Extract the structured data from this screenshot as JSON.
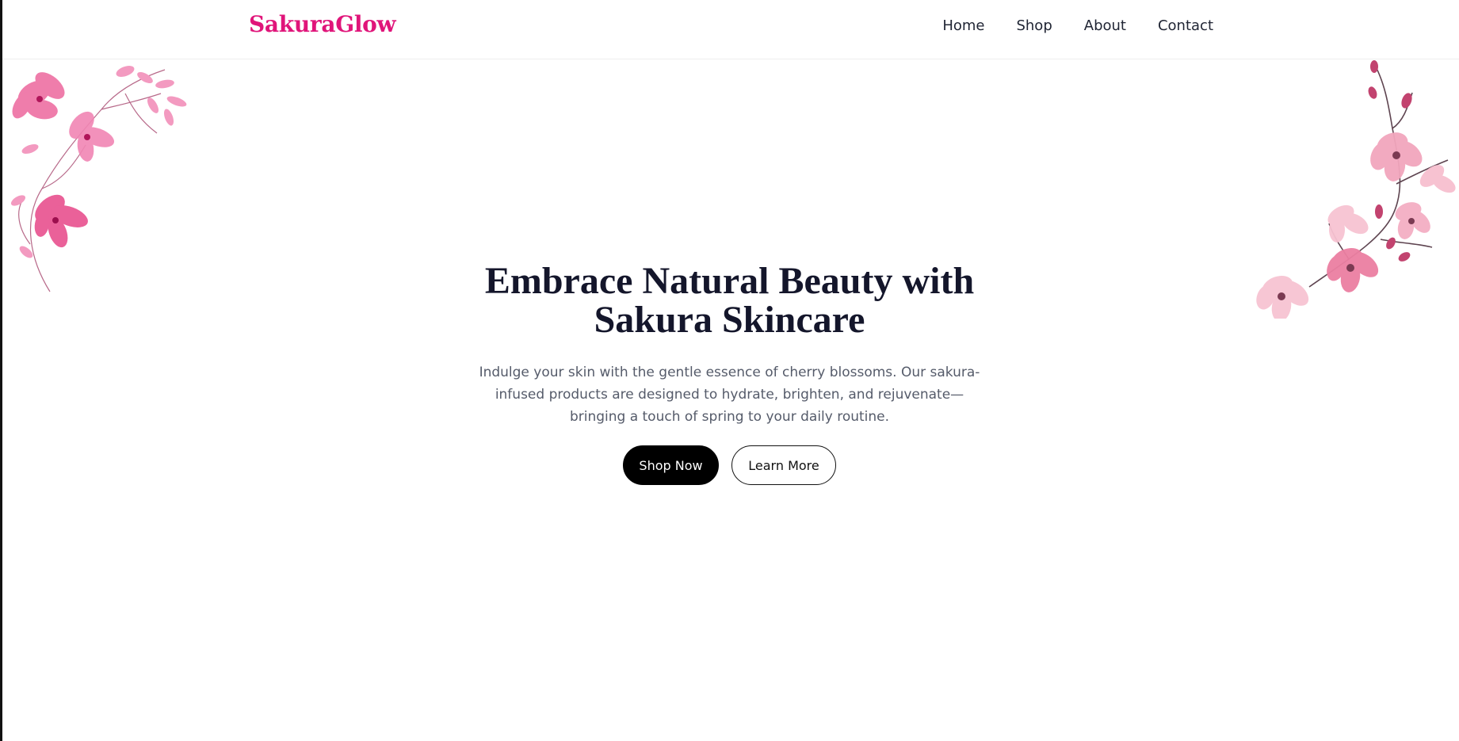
{
  "colors": {
    "brand": "#e0157a",
    "heading": "#14162b",
    "body_text": "#555b6a",
    "nav_text": "#1f2433",
    "primary_button_bg": "#000000",
    "blossom_left": "#e8508e",
    "blossom_right": "#f2a6bd"
  },
  "header": {
    "brand": "SakuraGlow",
    "nav": [
      {
        "label": "Home"
      },
      {
        "label": "Shop"
      },
      {
        "label": "About"
      },
      {
        "label": "Contact"
      }
    ]
  },
  "decor": {
    "left_icon": "cherry-blossom-branch-icon",
    "right_icon": "cherry-blossom-branch-icon"
  },
  "hero": {
    "title_line1": "Embrace Natural Beauty with",
    "title_line2": "Sakura Skincare",
    "description": "Indulge your skin with the gentle essence of cherry blossoms. Our sakura-infused products are designed to hydrate, brighten, and rejuvenate—bringing a touch of spring to your daily routine.",
    "primary_button": "Shop Now",
    "secondary_button": "Learn More"
  }
}
